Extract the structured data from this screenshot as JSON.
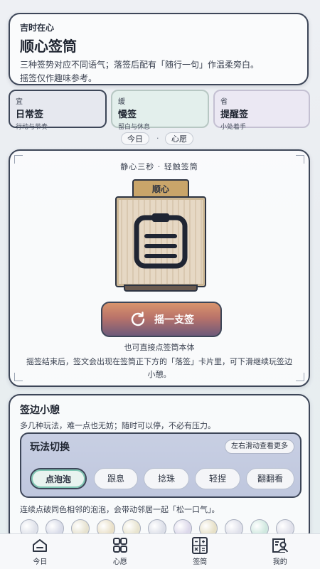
{
  "header": {
    "eyebrow": "吉时在心",
    "title": "顺心签筒",
    "desc_line1": "三种签势对应不同语气；落签后配有「随行一句」作温柔旁白。",
    "desc_line2": "摇签仅作趣味参考。"
  },
  "modes": [
    {
      "tag": "宜",
      "name": "日常签",
      "sub": "行动与节奏",
      "color": "#e6e8ef"
    },
    {
      "tag": "缓",
      "name": "慢签",
      "sub": "留白与休息",
      "color": "#e3efec"
    },
    {
      "tag": "省",
      "name": "提醒签",
      "sub": "小处着手",
      "color": "#ebe8f3"
    }
  ],
  "segment": {
    "today": "今日",
    "dot": "·",
    "wish": "心愿"
  },
  "stick": {
    "hint": "静心三秒 · 轻触签筒",
    "lid_label": "顺心",
    "shake_label": "摇一支签",
    "tap_hint": "也可直接点签筒本体",
    "after_desc": "摇签结束后，签文会出现在签筒正下方的「落签」卡片里，可下滑继续玩签边小憩。"
  },
  "games": {
    "title": "签边小憩",
    "desc": "多几种玩法，难一点也无妨；随时可以停，不必有压力。",
    "switch_title": "玩法切换",
    "more_label": "左右滑动查看更多",
    "chips": [
      "点泡泡",
      "跟息",
      "捻珠",
      "轻捏",
      "翻翻看"
    ],
    "note": "连续点破同色相邻的泡泡，会带动邻居一起「松一口气」。",
    "bubble_colors": [
      "#dfe2ea",
      "#d8dbe8",
      "#e6e2cf",
      "#e9e0c8",
      "#e8e4cf",
      "#dcdfe8",
      "#dcd8ea",
      "#e6e0c7",
      "#dfe0ea",
      "#cfe8df",
      "#dfe0ea"
    ]
  },
  "tabbar": {
    "items": [
      {
        "label": "今日",
        "icon": "home-icon"
      },
      {
        "label": "心愿",
        "icon": "grid-icon"
      },
      {
        "label": "签筒",
        "icon": "calculator-icon"
      },
      {
        "label": "我的",
        "icon": "profile-icon"
      }
    ]
  }
}
